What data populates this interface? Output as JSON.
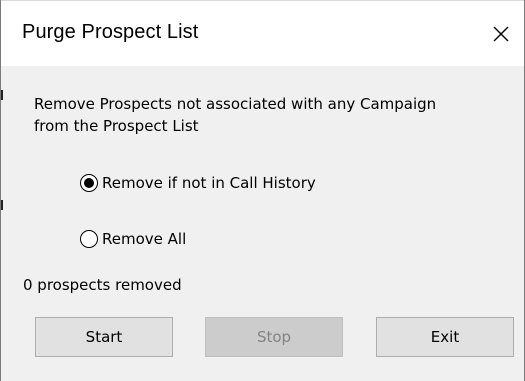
{
  "window": {
    "title": "Purge Prospect List",
    "close_label": "✕"
  },
  "description": "Remove Prospects not associated with any Campaign from the Prospect List",
  "options": [
    {
      "label": "Remove if not in Call History",
      "selected": true
    },
    {
      "label": "Remove All",
      "selected": false
    }
  ],
  "status": "0 prospects removed",
  "buttons": {
    "start": {
      "label": "Start",
      "enabled": true
    },
    "stop": {
      "label": "Stop",
      "enabled": false
    },
    "exit": {
      "label": "Exit",
      "enabled": true
    }
  }
}
